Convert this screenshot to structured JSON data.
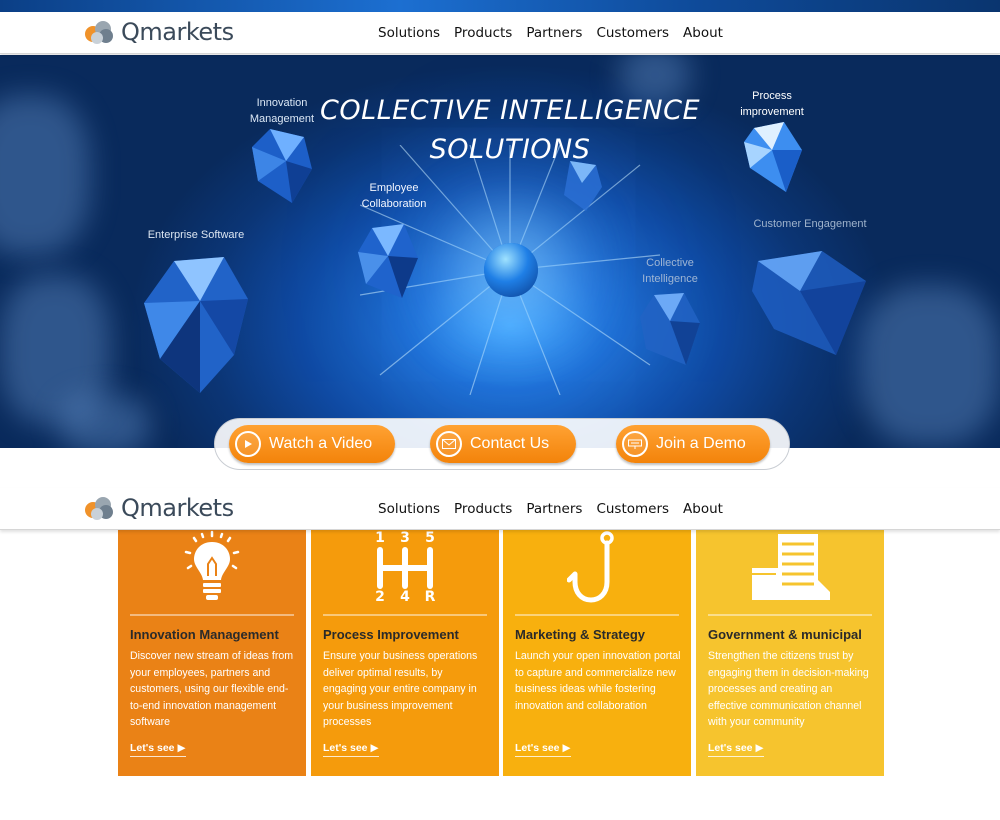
{
  "brand": {
    "name": "Qmarkets"
  },
  "nav": [
    "Solutions",
    "Products",
    "Partners",
    "Customers",
    "About"
  ],
  "hero": {
    "title_line1": "COLLECTIVE INTELLIGENCE",
    "title_line2": "SOLUTIONS",
    "labels": {
      "innovation_l1": "Innovation",
      "innovation_l2": "Management",
      "employee_l1": "Employee",
      "employee_l2": "Collaboration",
      "enterprise": "Enterprise Software",
      "process_l1": "Process",
      "process_l2": "improvement",
      "customer": "Customer Engagement",
      "collective_l1": "Collective",
      "collective_l2": "Intelligence"
    }
  },
  "cta": {
    "watch": "Watch a Video",
    "contact": "Contact Us",
    "demo": "Join a Demo"
  },
  "cards": [
    {
      "title": "Innovation Management",
      "text": "Discover new stream of ideas from your employees, partners and customers, using our flexible end-to-end innovation management software",
      "link": "Let's see ▶",
      "color": "#ea8216",
      "icon": "lightbulb-icon"
    },
    {
      "title": "Process Improvement",
      "text": "Ensure your business operations deliver optimal results, by engaging your entire company in your business improvement processes",
      "link": "Let's see ▶",
      "color": "#f59b0c",
      "icon": "gear-shift-icon",
      "gear_digits": {
        "top": [
          "1",
          "3",
          "5"
        ],
        "bottom": [
          "2",
          "4",
          "R"
        ]
      }
    },
    {
      "title": "Marketing & Strategy",
      "text": "Launch your open innovation portal to capture and commercialize new business ideas while fostering innovation and collaboration",
      "link": "Let's see ▶",
      "color": "#f8b00e",
      "icon": "fishing-hook-icon"
    },
    {
      "title": "Government & municipal",
      "text": "Strengthen the citizens trust by engaging them in decision-making processes and creating an effective communication channel with your community",
      "link": "Let's see ▶",
      "color": "#f6c42e",
      "icon": "building-icon"
    }
  ]
}
